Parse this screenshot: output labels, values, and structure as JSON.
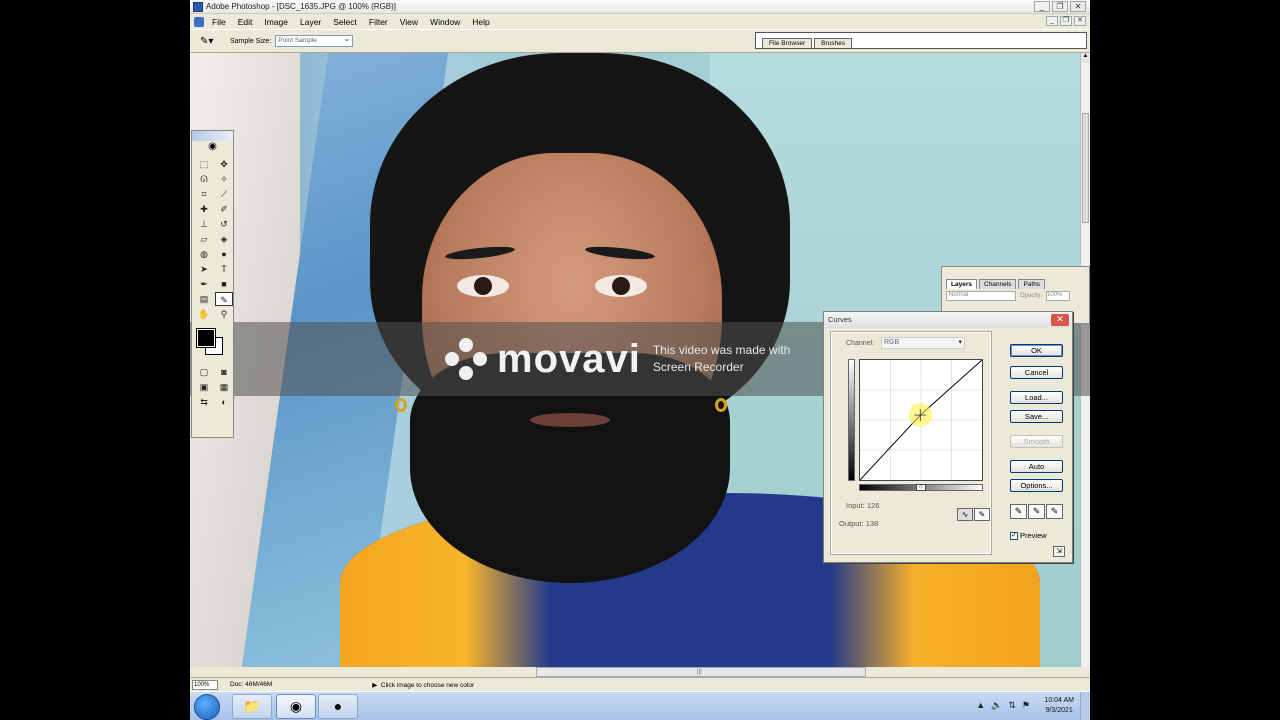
{
  "window": {
    "title": "Adobe Photoshop - [DSC_1635.JPG @ 100% (RGB)]",
    "controls": {
      "minimize": "_",
      "restore": "❐",
      "close": "✕"
    }
  },
  "menubar": {
    "items": [
      "File",
      "Edit",
      "Image",
      "Layer",
      "Select",
      "Filter",
      "View",
      "Window",
      "Help"
    ],
    "doc_controls": {
      "minimize": "_",
      "restore": "❐",
      "close": "✕"
    }
  },
  "options": {
    "tool_icon": "eyedropper-icon",
    "sample_size_label": "Sample Size:",
    "sample_size_value": "Point Sample"
  },
  "palette_well": {
    "tabs": [
      "File Browser",
      "Brushes"
    ]
  },
  "watermark": {
    "brand": "movavi",
    "line1": "This video was made with",
    "line2": "Screen Recorder"
  },
  "layers_palette": {
    "tabs": [
      "Layers",
      "Channels",
      "Paths"
    ],
    "blend_mode": "Normal",
    "opacity_label": "Opacity:",
    "opacity_value": "100%"
  },
  "curves": {
    "title": "Curves",
    "channel_label": "Channel:",
    "channel_value": "RGB",
    "input_label": "Input:",
    "input_value": "126",
    "output_label": "Output:",
    "output_value": "138",
    "buttons": {
      "ok": "OK",
      "cancel": "Cancel",
      "load": "Load...",
      "save": "Save...",
      "smooth": "Smooth",
      "auto": "Auto",
      "options": "Options..."
    },
    "preview_label": "Preview",
    "preview_checked": true,
    "curve": {
      "point_input": 126,
      "point_output": 138,
      "range": [
        0,
        255
      ]
    }
  },
  "statusbar": {
    "zoom": "100%",
    "doc": "Doc: 46M/46M",
    "tip": "Click image to choose new color"
  },
  "taskbar": {
    "clock_time": "10:04 AM",
    "clock_date": "9/3/2021"
  },
  "colors": {
    "foreground": "#000000",
    "background": "#ffffff",
    "scarf": "#f4a521",
    "shirt": "#233a8a"
  }
}
